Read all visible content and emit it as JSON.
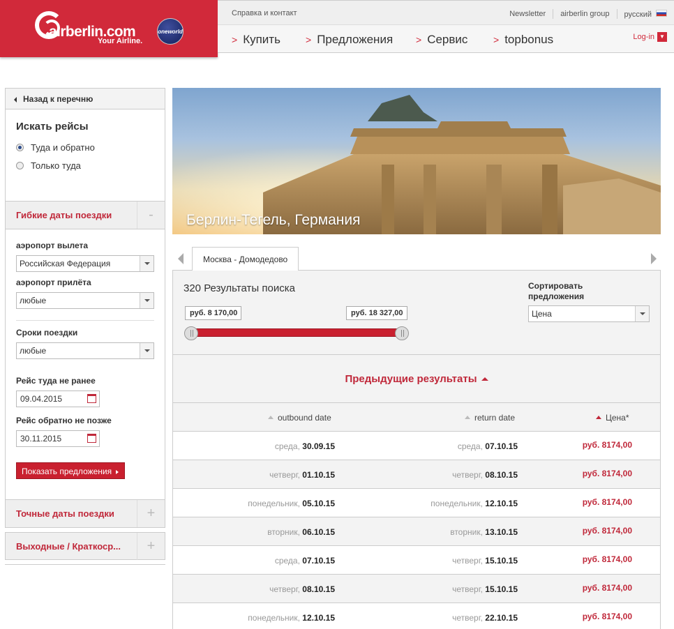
{
  "header": {
    "brand": "airberlin.com",
    "tagline": "Your Airline.",
    "alliance": "oneworld",
    "help_link": "Справка и контакт",
    "top_links": [
      "Newsletter",
      "airberlin group",
      "русский"
    ],
    "nav": [
      "Купить",
      "Предложения",
      "Сервис",
      "topbonus"
    ],
    "login": "Log-in"
  },
  "sidebar": {
    "back": "Назад к перечню",
    "search_title": "Искать рейсы",
    "trip_options": [
      "Туда и обратно",
      "Только туда"
    ],
    "flex_section": "Гибкие даты поездки",
    "flex_toggle": "-",
    "departure_label": "аэропорт вылета",
    "departure_value": "Российская Федерация",
    "arrival_label": "аэропорт прилёта",
    "arrival_value": "любые",
    "duration_label": "Сроки поездки",
    "duration_value": "любые",
    "out_label": "Рейс туда не ранее",
    "out_date": "09.04.2015",
    "ret_label": "Рейс обратно не позже",
    "ret_date": "30.11.2015",
    "show_button": "Показать предложения",
    "exact_section": "Точные даты поездки",
    "weekend_section": "Выходные / Краткоср...",
    "plus": "+"
  },
  "hero": {
    "caption": "Берлин-Тегель, Германия"
  },
  "tabs": {
    "active": "Москва - Домодедово"
  },
  "results": {
    "count_text": "320 Результаты поиска",
    "sort_label": "Сортировать предложения",
    "sort_value": "Цена",
    "price_min": "руб. 8 170,00",
    "price_max": "руб. 18 327,00",
    "previous": "Предыдущие результаты",
    "col_outbound": "outbound date",
    "col_return": "return date",
    "col_price": "Цена*",
    "rows": [
      {
        "out_day": "среда, ",
        "out_date": "30.09.15",
        "ret_day": "среда, ",
        "ret_date": "07.10.15",
        "price": "руб. 8174,00"
      },
      {
        "out_day": "четверг, ",
        "out_date": "01.10.15",
        "ret_day": "четверг, ",
        "ret_date": "08.10.15",
        "price": "руб. 8174,00"
      },
      {
        "out_day": "понедельник, ",
        "out_date": "05.10.15",
        "ret_day": "понедельник, ",
        "ret_date": "12.10.15",
        "price": "руб. 8174,00"
      },
      {
        "out_day": "вторник, ",
        "out_date": "06.10.15",
        "ret_day": "вторник, ",
        "ret_date": "13.10.15",
        "price": "руб. 8174,00"
      },
      {
        "out_day": "среда, ",
        "out_date": "07.10.15",
        "ret_day": "четверг, ",
        "ret_date": "15.10.15",
        "price": "руб. 8174,00"
      },
      {
        "out_day": "четверг, ",
        "out_date": "08.10.15",
        "ret_day": "четверг, ",
        "ret_date": "15.10.15",
        "price": "руб. 8174,00"
      },
      {
        "out_day": "понедельник, ",
        "out_date": "12.10.15",
        "ret_day": "четверг, ",
        "ret_date": "22.10.15",
        "price": "руб. 8174,00"
      }
    ]
  },
  "colors": {
    "brand_red": "#d1293a",
    "link_red": "#c0283a"
  }
}
